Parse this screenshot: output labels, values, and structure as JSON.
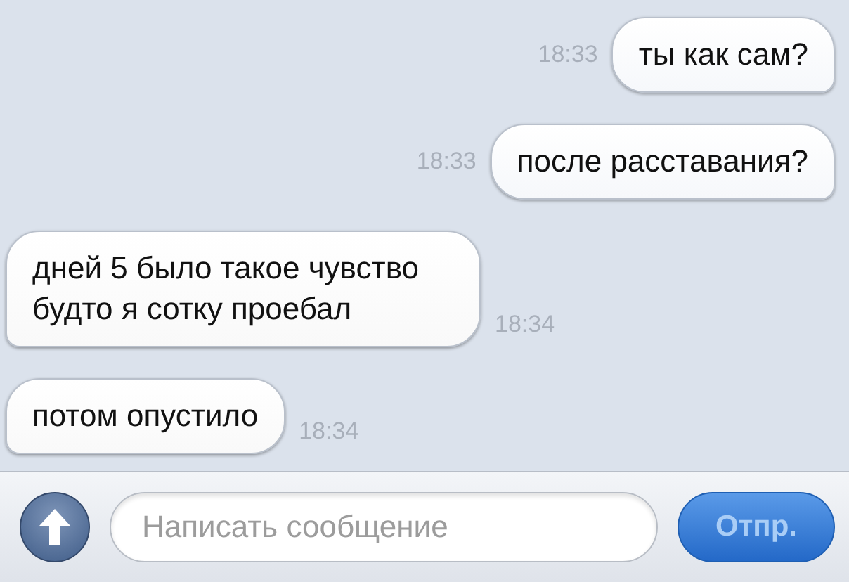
{
  "messages": [
    {
      "outgoing": true,
      "text": "ты как сам?",
      "time": "18:33"
    },
    {
      "outgoing": true,
      "text": "после расставания?",
      "time": "18:33"
    },
    {
      "outgoing": false,
      "text": "дней 5 было такое чувство будто я сотку проебал",
      "time": "18:34"
    },
    {
      "outgoing": false,
      "text": "потом опустило",
      "time": "18:34"
    }
  ],
  "composer": {
    "placeholder": "Написать сообщение",
    "send_label": "Отпр."
  }
}
